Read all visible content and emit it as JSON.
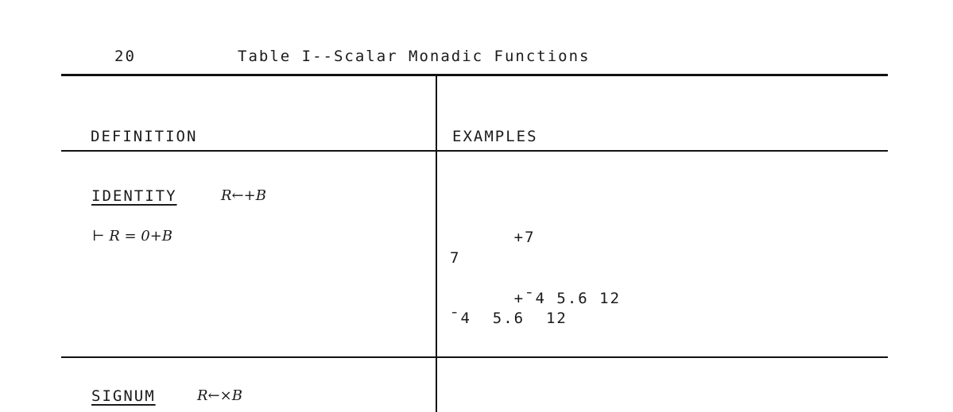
{
  "header": {
    "page_number": "20",
    "title": "Table I--Scalar Monadic Functions"
  },
  "columns": {
    "definition": "DEFINITION",
    "examples": "EXAMPLES"
  },
  "rows": [
    {
      "name": "IDENTITY",
      "syntax": "R←+B",
      "definition_line": "⊢ R = 0+B",
      "examples": [
        "      +7",
        "7",
        "",
        "      +¯4 5.6 12",
        "¯4  5.6  12"
      ]
    },
    {
      "name": "SIGNUM",
      "syntax": "R←×B"
    }
  ]
}
